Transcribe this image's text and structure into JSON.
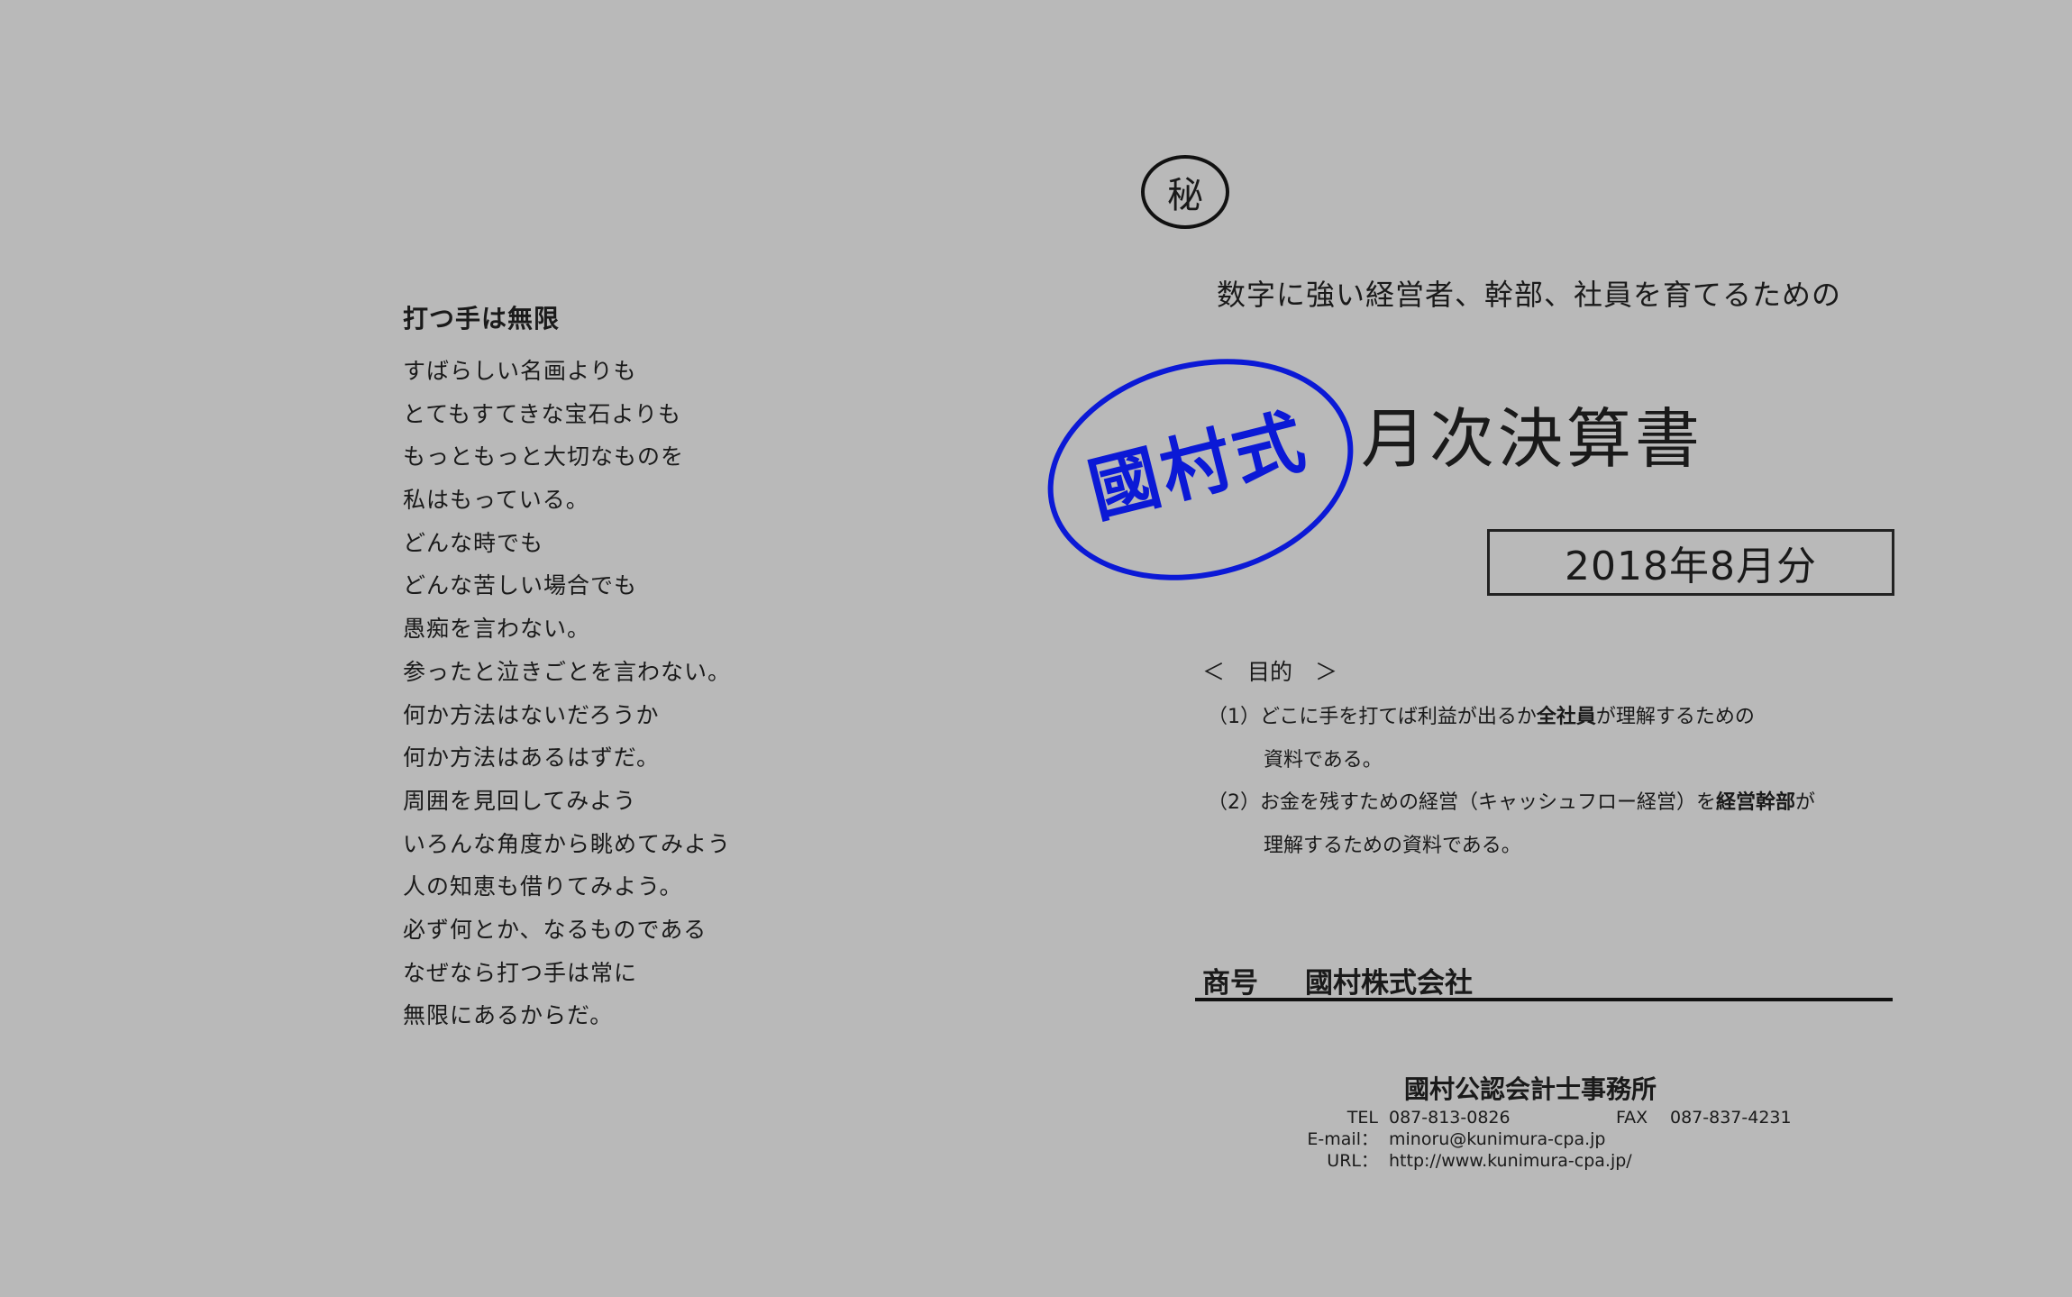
{
  "poem": {
    "title": "打つ手は無限",
    "lines": [
      "すばらしい名画よりも",
      "とてもすてきな宝石よりも",
      "もっともっと大切なものを",
      "私はもっている。",
      "どんな時でも",
      "どんな苦しい場合でも",
      "愚痴を言わない。",
      "参ったと泣きごとを言わない。",
      "何か方法はないだろうか",
      "何か方法はあるはずだ。",
      "周囲を見回してみよう",
      "いろんな角度から眺めてみよう",
      "人の知恵も借りてみよう。",
      "必ず何とか、なるものである",
      "なぜなら打つ手は常に",
      "無限にあるからだ。"
    ]
  },
  "cover": {
    "secret_mark": "秘",
    "subtitle": "数字に強い経営者、幹部、社員を育てるための",
    "stamp_text": "國村式",
    "stamp_color": "#0b19d6",
    "title": "月次決算書",
    "period": "2018年8月分"
  },
  "purpose": {
    "heading": "＜　目的　＞",
    "item1_a": "（1）どこに手を打てば利益が出るか",
    "item1_bold": "全社員",
    "item1_b": "が理解するための",
    "item1_cont": "資料である。",
    "item2_a": "（2）お金を残すための経営（キャッシュフロー経営）を",
    "item2_bold": "経営幹部",
    "item2_b": "が",
    "item2_cont": "理解するための資料である。"
  },
  "company": {
    "label": "商号",
    "name": "國村株式会社"
  },
  "office": {
    "name": "國村公認会計士事務所",
    "tel_label": "TEL",
    "tel": "087-813-0826",
    "fax_label": "FAX",
    "fax": "087-837-4231",
    "email_label": "E-mail：",
    "email": "minoru@kunimura-cpa.jp",
    "url_label": "URL：",
    "url": "http://www.kunimura-cpa.jp/"
  }
}
